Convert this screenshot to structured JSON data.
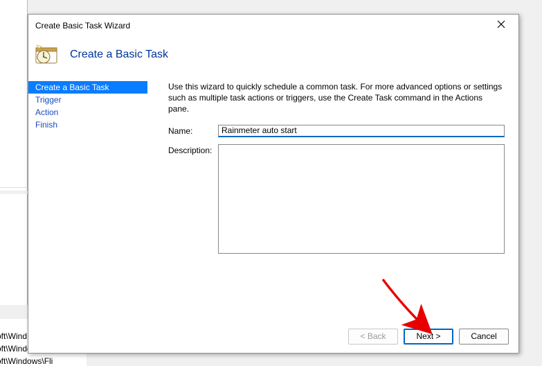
{
  "window": {
    "title": "Create Basic Task Wizard"
  },
  "header": {
    "heading": "Create a Basic Task"
  },
  "steps": [
    {
      "label": "Create a Basic Task",
      "selected": true
    },
    {
      "label": "Trigger",
      "selected": false
    },
    {
      "label": "Action",
      "selected": false
    },
    {
      "label": "Finish",
      "selected": false
    }
  ],
  "content": {
    "intro": "Use this wizard to quickly schedule a common task.  For more advanced options or settings such as multiple task actions or triggers, use the Create Task command in the Actions pane.",
    "name_label": "Name:",
    "name_value": "Rainmeter auto start",
    "description_label": "Description:",
    "description_value": ""
  },
  "buttons": {
    "back": "< Back",
    "next": "Next >",
    "cancel": "Cancel"
  },
  "background": {
    "line1": "oft\\Wind",
    "line2": "oft\\Windows\\U...",
    "line3": "oft\\Windows\\Fli"
  }
}
